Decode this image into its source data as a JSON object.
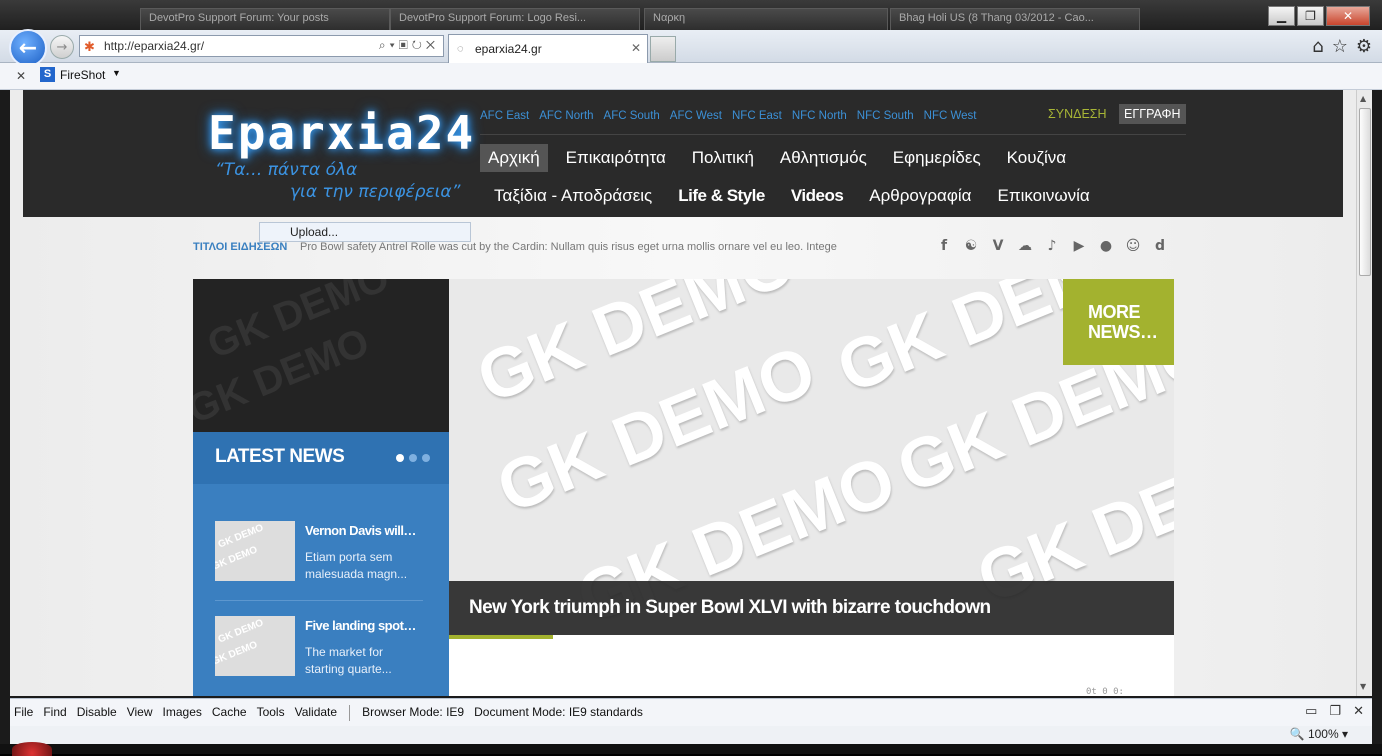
{
  "browser": {
    "ghost_tabs": [
      "DevotPro Support Forum: Your posts",
      "DevotPro Support Forum: Logo Resi...",
      "Ναρκη",
      "Bhag Holi US (8 Thang 03/2012 - Cao..."
    ],
    "url": "http://eparxia24.gr/",
    "active_tab": "eparxia24.gr",
    "fireshot": "FireShot"
  },
  "site": {
    "logo": "Eparxia24",
    "slogan_line1": "“Τα… πάντα όλα",
    "slogan_line2": "για την περιφέρεια”",
    "subnav": [
      "AFC East",
      "AFC North",
      "AFC South",
      "AFC West",
      "NFC East",
      "NFC North",
      "NFC South",
      "NFC West"
    ],
    "login": "ΣΥΝΔΕΣΗ",
    "register": "ΕΓΓΡΑΦΗ",
    "menu1": [
      "Αρχική",
      "Επικαιρότητα",
      "Πολιτική",
      "Αθλητισμός",
      "Εφημερίδες",
      "Κουζίνα"
    ],
    "menu2": [
      "Ταξίδια - Αποδράσεις",
      "Life & Style",
      "Videos",
      "Αρθρογραφία",
      "Επικοινωνία"
    ],
    "upload": "Upload...",
    "ticker_label": "ΤΙΤΛΟΙ ΕΙΔΗΣΕΩΝ",
    "ticker_text": "Pro Bowl safety Antrel Rolle was cut by the Cardin: Nullam quis risus eget urna mollis ornare vel eu leo. Intege",
    "social_icons": [
      "facebook-icon",
      "stumbleupon-icon",
      "vimeo-icon",
      "messenger-icon",
      "twitter-icon",
      "youtube-icon",
      "chat-icon",
      "people-icon",
      "delicious-icon"
    ],
    "latest_news": "LATEST NEWS",
    "news_items": [
      {
        "title": "Vernon Davis will…",
        "excerpt": "Etiam porta sem malesuada magn..."
      },
      {
        "title": "Five landing spot…",
        "excerpt": "The market for starting quarte..."
      }
    ],
    "more_news_1": "MORE",
    "more_news_2": "NEWS…",
    "hero_caption": "New York triumph in Super Bowl XLVI with bizarre touchdown",
    "watermark": "GK DEMO",
    "tiny_text": "0t 0 0:"
  },
  "devtools": {
    "items": [
      "File",
      "Find",
      "Disable",
      "View",
      "Images",
      "Cache",
      "Tools",
      "Validate"
    ],
    "browser_mode": "Browser Mode: IE9",
    "document_mode": "Document Mode: IE9 standards"
  },
  "status": {
    "zoom": "100%"
  }
}
